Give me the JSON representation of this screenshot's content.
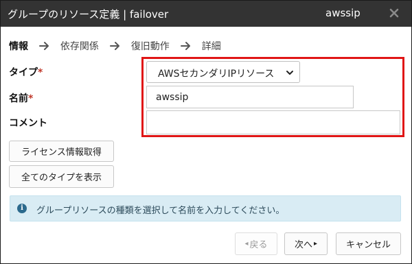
{
  "window": {
    "title": "グループのリソース定義 | failover",
    "resource_name": "awssip",
    "close_icon": "close-icon"
  },
  "steps": [
    {
      "label": "情報",
      "active": true
    },
    {
      "label": "依存関係",
      "active": false
    },
    {
      "label": "復旧動作",
      "active": false
    },
    {
      "label": "詳細",
      "active": false
    }
  ],
  "form": {
    "type_label": "タイプ",
    "type_value": "AWSセカンダリIPリソース",
    "name_label": "名前",
    "name_value": "awssip",
    "comment_label": "コメント",
    "comment_value": "",
    "required_mark": "*"
  },
  "buttons": {
    "license": "ライセンス情報取得",
    "show_all_types": "全てのタイプを表示",
    "back": "戻る",
    "back_prefix": "◂",
    "next": "次へ",
    "next_suffix": "▸",
    "cancel": "キャンセル"
  },
  "info": {
    "icon": "info-icon",
    "text": "グループリソースの種類を選択して名前を入力してください。"
  },
  "colors": {
    "titlebar": "#333333",
    "highlight": "#e01515",
    "info_bg": "#d9ecf4",
    "required": "#c0392b"
  }
}
